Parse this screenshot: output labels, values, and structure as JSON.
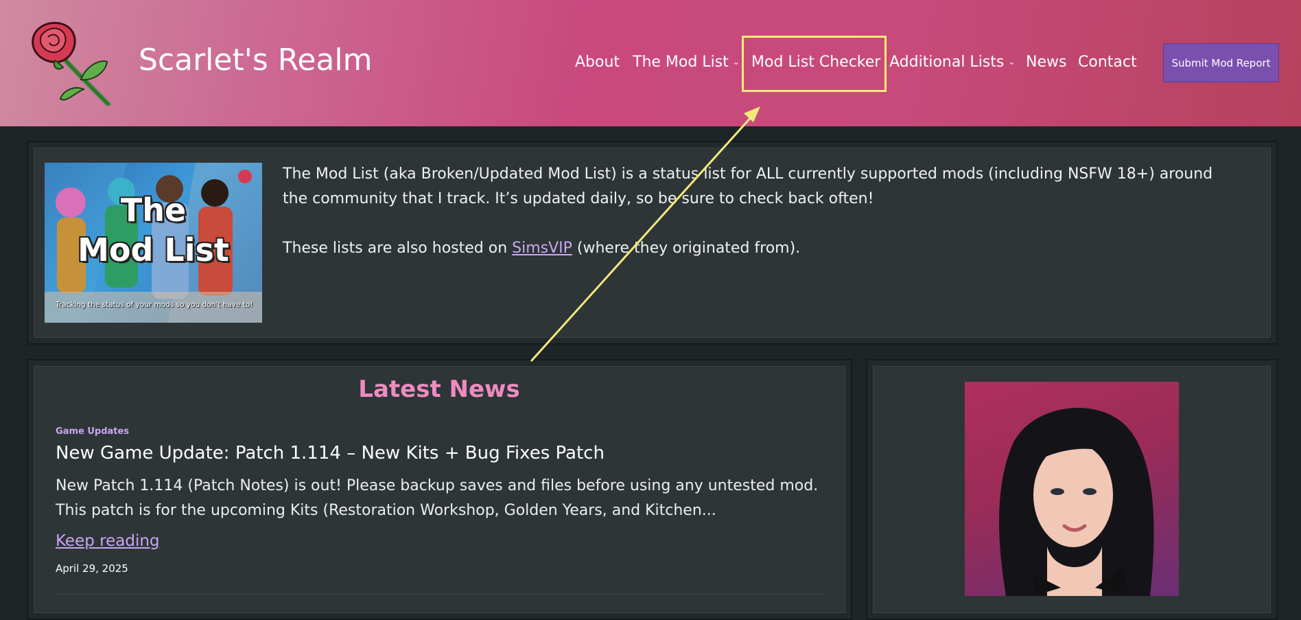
{
  "site": {
    "title": "Scarlet's Realm",
    "logo_icon": "rose-icon",
    "brand_colors": {
      "header_pink": "#c9497d",
      "link_purple": "#c9a6f2",
      "news_pink": "#f08ac0",
      "button_purple": "#7a4fae",
      "highlight_yellow": "#f4ea7a"
    }
  },
  "nav": {
    "items": [
      {
        "label": "About",
        "has_dropdown": false
      },
      {
        "label": "The Mod List",
        "has_dropdown": true
      },
      {
        "label": "Mod List Checker",
        "has_dropdown": false,
        "highlighted": true
      },
      {
        "label": "Additional Lists",
        "has_dropdown": true
      },
      {
        "label": "News",
        "has_dropdown": false
      },
      {
        "label": "Contact",
        "has_dropdown": false
      }
    ],
    "cta": "Submit Mod Report"
  },
  "intro": {
    "image": {
      "title_line1": "The",
      "title_line2": "Mod List",
      "caption": "Tracking the status of your mods so you don't have to!"
    },
    "paragraph1": "The Mod List (aka Broken/Updated Mod List) is a status list for ALL currently supported mods (including NSFW 18+) around the community that I track. It’s updated daily, so be sure to check back often!",
    "paragraph2_before": "These lists are also hosted on ",
    "paragraph2_link": "SimsVIP",
    "paragraph2_after": " (where they originated from)."
  },
  "news": {
    "heading": "Latest News",
    "posts": [
      {
        "category": "Game Updates",
        "title": "New Game Update: Patch 1.114 – New Kits + Bug Fixes Patch",
        "excerpt": "New Patch 1.114 (Patch Notes) is out! Please backup saves and files before using any untested mod. This patch is for the upcoming Kits (Restoration Workshop, Golden Years, and Kitchen...",
        "read_more": "Keep reading",
        "date": "April 29, 2025"
      }
    ]
  }
}
